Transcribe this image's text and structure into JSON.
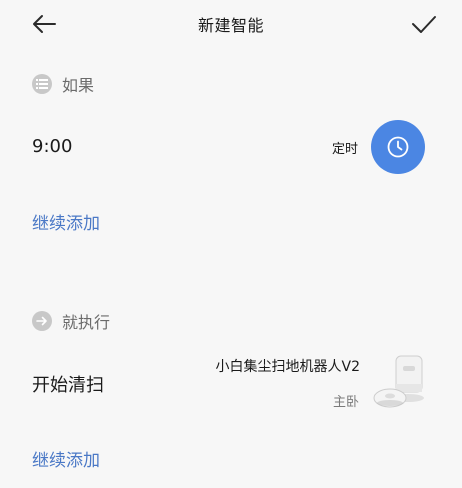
{
  "header": {
    "title": "新建智能"
  },
  "if_section": {
    "label": "如果",
    "condition": {
      "value": "9:00",
      "type_label": "定时"
    },
    "add_label": "继续添加"
  },
  "then_section": {
    "label": "就执行",
    "action": {
      "label": "开始清扫",
      "device_name": "小白集尘扫地机器人V2",
      "device_room": "主卧"
    },
    "add_label": "继续添加"
  },
  "colors": {
    "accent": "#4b86e3",
    "link": "#4a78c6",
    "background": "#f7f7f7"
  },
  "icons": {
    "back": "arrow-left-icon",
    "confirm": "check-icon",
    "if_section": "list-icon",
    "then_section": "arrow-right-circle-icon",
    "condition": "clock-icon",
    "device": "robot-vacuum-icon"
  }
}
